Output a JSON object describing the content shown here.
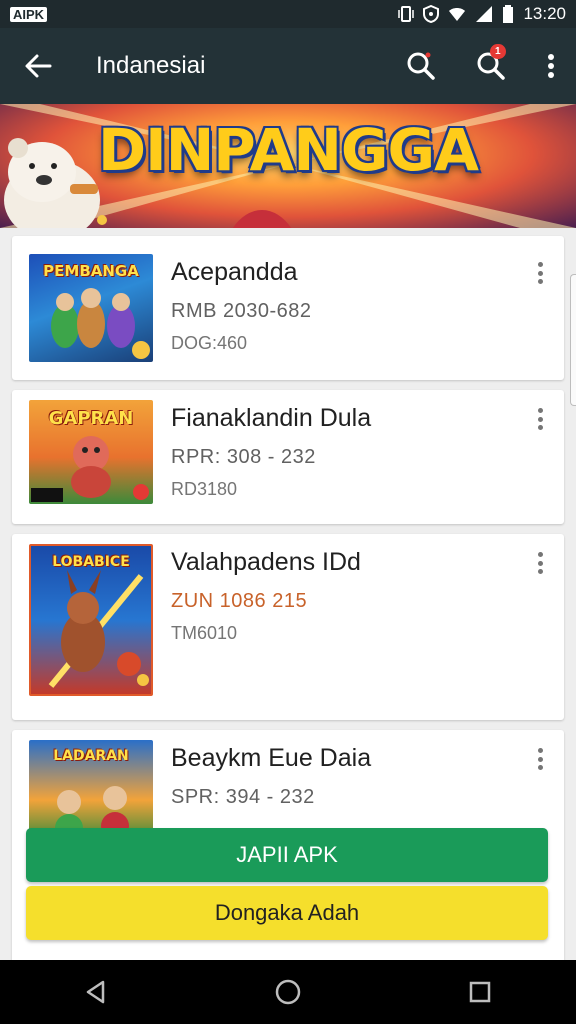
{
  "status_bar": {
    "logo": "AIPK",
    "time": "13:20",
    "icons": [
      "vibrate-icon",
      "shield-icon",
      "wifi-icon",
      "signal-icon",
      "battery-icon"
    ]
  },
  "app_bar": {
    "title": "Indanesiai",
    "badge": "1"
  },
  "banner": {
    "title": "DINPANGGA"
  },
  "list": [
    {
      "thumb_text": "PEMBANGA",
      "title": "Acepandda",
      "line1": "RMB 2030-682",
      "line2": "DOG:460"
    },
    {
      "thumb_text": "GAPRAN",
      "title": "Fianaklandin Dula",
      "line1": "RPR: 308 - 232",
      "line2": "RD3180"
    },
    {
      "thumb_text": "LOBABICE",
      "title": "Valahpadens IDd",
      "line1": "ZUN 1086 215",
      "line2": "TM6010"
    },
    {
      "thumb_text": "LADARAN",
      "title": "Beaykm Eue Daia",
      "line1": "SPR: 394 - 232",
      "line2": ""
    }
  ],
  "buttons": {
    "primary": "JAPII APK",
    "secondary": "Dongaka Adah"
  },
  "colors": {
    "app_bar": "#233237",
    "primary_button": "#1a9b59",
    "secondary_button": "#f5df2c",
    "price_highlight": "#c8622a"
  }
}
